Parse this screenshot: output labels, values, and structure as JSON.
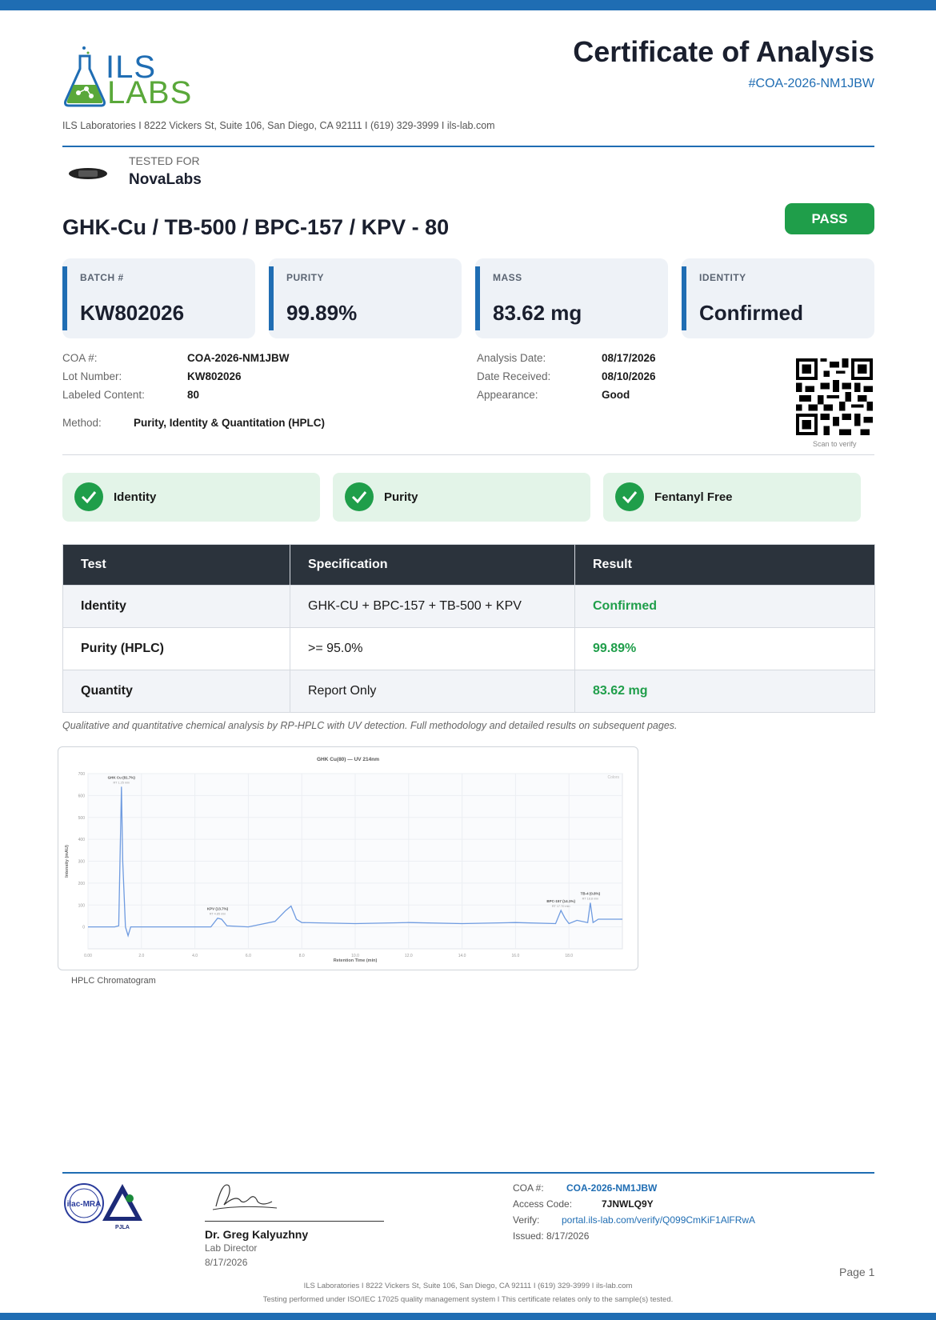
{
  "brand": {
    "logo_line1": "ILS",
    "logo_line2": "LABS",
    "accent": "#1f6db3",
    "green": "#5aa83a"
  },
  "lab_line": "ILS Laboratories  I  8222 Vickers St, Suite 106, San Diego, CA 92111  I  (619) 329-3999  I  ils-lab.com",
  "header": {
    "title": "Certificate of Analysis",
    "coa_id": "#COA-2026-NM1JBW"
  },
  "client": {
    "tested_for_label": "TESTED FOR",
    "name": "NovaLabs"
  },
  "product": "GHK-Cu / TB-500 / BPC-157 / KPV - 80",
  "status": {
    "label": "PASS",
    "color": "#1f9e4a"
  },
  "cards": [
    {
      "label": "BATCH #",
      "value": "KW802026"
    },
    {
      "label": "PURITY",
      "value": "99.89%"
    },
    {
      "label": "MASS",
      "value": "83.62 mg"
    },
    {
      "label": "IDENTITY",
      "value": "Confirmed"
    }
  ],
  "details_left": [
    {
      "key": "COA #:",
      "value": "COA-2026-NM1JBW"
    },
    {
      "key": "Lot Number:",
      "value": "KW802026"
    },
    {
      "key": "Labeled Content:",
      "value": "80"
    }
  ],
  "method": {
    "key": "Method:",
    "value": "Purity, Identity & Quantitation (HPLC)"
  },
  "details_right": [
    {
      "key": "Analysis Date:",
      "value": "08/17/2026"
    },
    {
      "key": "Date Received:",
      "value": "08/10/2026"
    },
    {
      "key": "Appearance:",
      "value": "Good"
    }
  ],
  "qr_caption": "Scan to verify",
  "checks": [
    "Identity",
    "Purity",
    "Fentanyl Free"
  ],
  "table": {
    "headers": [
      "Test",
      "Specification",
      "Result"
    ],
    "rows": [
      {
        "test": "Identity",
        "spec": "GHK-CU + BPC-157 + TB-500 + KPV",
        "result": "Confirmed"
      },
      {
        "test": "Purity (HPLC)",
        "spec": ">= 95.0%",
        "result": "99.89%"
      },
      {
        "test": "Quantity",
        "spec": "Report Only",
        "result": "83.62 mg"
      }
    ]
  },
  "note": "Qualitative and quantitative chemical analysis by RP-HPLC with UV detection. Full methodology and detailed results on subsequent pages.",
  "chart_data": {
    "type": "line",
    "title": "GHK Cu(80) — UV 214nm",
    "xlabel": "Retention Time (min)",
    "ylabel": "Intensity (mAU)",
    "xlim": [
      0,
      20
    ],
    "ylim": [
      -100,
      700
    ],
    "x_ticks": [
      "0.00",
      "2.0",
      "4.0",
      "6.0",
      "8.0",
      "10.0",
      "12.0",
      "14.0",
      "16.0",
      "18.0"
    ],
    "y_ticks": [
      "0",
      "100",
      "200",
      "300",
      "400",
      "500",
      "600",
      "700"
    ],
    "legend_text": "Colors",
    "series": [
      {
        "color": "#6f9be0",
        "x": [
          0,
          1.0,
          1.15,
          1.25,
          1.3,
          1.4,
          1.5,
          1.6,
          1.7,
          2.0,
          3.0,
          4.6,
          4.85,
          5.0,
          5.2,
          6.0,
          7.0,
          7.4,
          7.6,
          7.8,
          8.0,
          10.0,
          12.0,
          14.0,
          16.0,
          17.5,
          17.7,
          17.85,
          18.0,
          18.3,
          18.7,
          18.8,
          18.9,
          19.1,
          20.0
        ],
        "y": [
          0,
          0,
          5,
          640,
          300,
          0,
          -40,
          0,
          0,
          0,
          0,
          0,
          40,
          35,
          5,
          0,
          25,
          75,
          95,
          35,
          20,
          15,
          20,
          15,
          20,
          15,
          75,
          40,
          15,
          30,
          20,
          110,
          20,
          35,
          35
        ]
      }
    ],
    "annotations": [
      {
        "label": "GHK Cu (81.7%)",
        "sub": "RT 1.25 min",
        "x": 1.25,
        "y": 640
      },
      {
        "label": "KPV (13.7%)",
        "sub": "RT 4.85 min",
        "x": 4.85,
        "y": 40
      },
      {
        "label": "BPC-157 (14.1%)",
        "sub": "RT 17.70 min",
        "x": 17.7,
        "y": 75
      },
      {
        "label": "TB-4 (0.8%)",
        "sub": "RT 18.8 min",
        "x": 18.8,
        "y": 110
      }
    ]
  },
  "chart_caption": "HPLC Chromatogram",
  "signer": {
    "name": "Dr. Greg Kalyuzhny",
    "role": "Lab Director",
    "date": "8/17/2026"
  },
  "footer_info": {
    "coa_label": "COA #:",
    "coa_value": "COA-2026-NM1JBW",
    "access_label": "Access Code:",
    "access_value": "7JNWLQ9Y",
    "verify_label": "Verify:",
    "verify_value": "portal.ils-lab.com/verify/Q099CmKiF1AlFRwA",
    "issued": "Issued: 8/17/2026"
  },
  "page_label": "Page 1",
  "footer_line1": "ILS Laboratories  I  8222 Vickers St, Suite 106, San Diego, CA 92111  I  (619) 329-3999  I  ils-lab.com",
  "footer_line2": "Testing performed under ISO/IEC 17025 quality management system  I  This certificate relates only to the sample(s) tested.",
  "accreditation": {
    "ilac_text": "ilac-MRA",
    "pjla_text": "PJLA"
  }
}
